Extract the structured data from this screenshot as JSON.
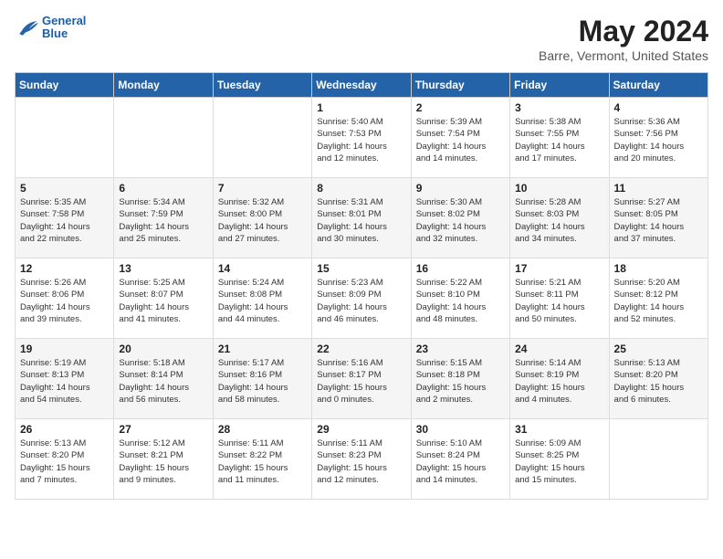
{
  "header": {
    "logo_line1": "General",
    "logo_line2": "Blue",
    "title": "May 2024",
    "subtitle": "Barre, Vermont, United States"
  },
  "days_of_week": [
    "Sunday",
    "Monday",
    "Tuesday",
    "Wednesday",
    "Thursday",
    "Friday",
    "Saturday"
  ],
  "weeks": [
    [
      {
        "num": "",
        "info": ""
      },
      {
        "num": "",
        "info": ""
      },
      {
        "num": "",
        "info": ""
      },
      {
        "num": "1",
        "info": "Sunrise: 5:40 AM\nSunset: 7:53 PM\nDaylight: 14 hours\nand 12 minutes."
      },
      {
        "num": "2",
        "info": "Sunrise: 5:39 AM\nSunset: 7:54 PM\nDaylight: 14 hours\nand 14 minutes."
      },
      {
        "num": "3",
        "info": "Sunrise: 5:38 AM\nSunset: 7:55 PM\nDaylight: 14 hours\nand 17 minutes."
      },
      {
        "num": "4",
        "info": "Sunrise: 5:36 AM\nSunset: 7:56 PM\nDaylight: 14 hours\nand 20 minutes."
      }
    ],
    [
      {
        "num": "5",
        "info": "Sunrise: 5:35 AM\nSunset: 7:58 PM\nDaylight: 14 hours\nand 22 minutes."
      },
      {
        "num": "6",
        "info": "Sunrise: 5:34 AM\nSunset: 7:59 PM\nDaylight: 14 hours\nand 25 minutes."
      },
      {
        "num": "7",
        "info": "Sunrise: 5:32 AM\nSunset: 8:00 PM\nDaylight: 14 hours\nand 27 minutes."
      },
      {
        "num": "8",
        "info": "Sunrise: 5:31 AM\nSunset: 8:01 PM\nDaylight: 14 hours\nand 30 minutes."
      },
      {
        "num": "9",
        "info": "Sunrise: 5:30 AM\nSunset: 8:02 PM\nDaylight: 14 hours\nand 32 minutes."
      },
      {
        "num": "10",
        "info": "Sunrise: 5:28 AM\nSunset: 8:03 PM\nDaylight: 14 hours\nand 34 minutes."
      },
      {
        "num": "11",
        "info": "Sunrise: 5:27 AM\nSunset: 8:05 PM\nDaylight: 14 hours\nand 37 minutes."
      }
    ],
    [
      {
        "num": "12",
        "info": "Sunrise: 5:26 AM\nSunset: 8:06 PM\nDaylight: 14 hours\nand 39 minutes."
      },
      {
        "num": "13",
        "info": "Sunrise: 5:25 AM\nSunset: 8:07 PM\nDaylight: 14 hours\nand 41 minutes."
      },
      {
        "num": "14",
        "info": "Sunrise: 5:24 AM\nSunset: 8:08 PM\nDaylight: 14 hours\nand 44 minutes."
      },
      {
        "num": "15",
        "info": "Sunrise: 5:23 AM\nSunset: 8:09 PM\nDaylight: 14 hours\nand 46 minutes."
      },
      {
        "num": "16",
        "info": "Sunrise: 5:22 AM\nSunset: 8:10 PM\nDaylight: 14 hours\nand 48 minutes."
      },
      {
        "num": "17",
        "info": "Sunrise: 5:21 AM\nSunset: 8:11 PM\nDaylight: 14 hours\nand 50 minutes."
      },
      {
        "num": "18",
        "info": "Sunrise: 5:20 AM\nSunset: 8:12 PM\nDaylight: 14 hours\nand 52 minutes."
      }
    ],
    [
      {
        "num": "19",
        "info": "Sunrise: 5:19 AM\nSunset: 8:13 PM\nDaylight: 14 hours\nand 54 minutes."
      },
      {
        "num": "20",
        "info": "Sunrise: 5:18 AM\nSunset: 8:14 PM\nDaylight: 14 hours\nand 56 minutes."
      },
      {
        "num": "21",
        "info": "Sunrise: 5:17 AM\nSunset: 8:16 PM\nDaylight: 14 hours\nand 58 minutes."
      },
      {
        "num": "22",
        "info": "Sunrise: 5:16 AM\nSunset: 8:17 PM\nDaylight: 15 hours\nand 0 minutes."
      },
      {
        "num": "23",
        "info": "Sunrise: 5:15 AM\nSunset: 8:18 PM\nDaylight: 15 hours\nand 2 minutes."
      },
      {
        "num": "24",
        "info": "Sunrise: 5:14 AM\nSunset: 8:19 PM\nDaylight: 15 hours\nand 4 minutes."
      },
      {
        "num": "25",
        "info": "Sunrise: 5:13 AM\nSunset: 8:20 PM\nDaylight: 15 hours\nand 6 minutes."
      }
    ],
    [
      {
        "num": "26",
        "info": "Sunrise: 5:13 AM\nSunset: 8:20 PM\nDaylight: 15 hours\nand 7 minutes."
      },
      {
        "num": "27",
        "info": "Sunrise: 5:12 AM\nSunset: 8:21 PM\nDaylight: 15 hours\nand 9 minutes."
      },
      {
        "num": "28",
        "info": "Sunrise: 5:11 AM\nSunset: 8:22 PM\nDaylight: 15 hours\nand 11 minutes."
      },
      {
        "num": "29",
        "info": "Sunrise: 5:11 AM\nSunset: 8:23 PM\nDaylight: 15 hours\nand 12 minutes."
      },
      {
        "num": "30",
        "info": "Sunrise: 5:10 AM\nSunset: 8:24 PM\nDaylight: 15 hours\nand 14 minutes."
      },
      {
        "num": "31",
        "info": "Sunrise: 5:09 AM\nSunset: 8:25 PM\nDaylight: 15 hours\nand 15 minutes."
      },
      {
        "num": "",
        "info": ""
      }
    ]
  ]
}
